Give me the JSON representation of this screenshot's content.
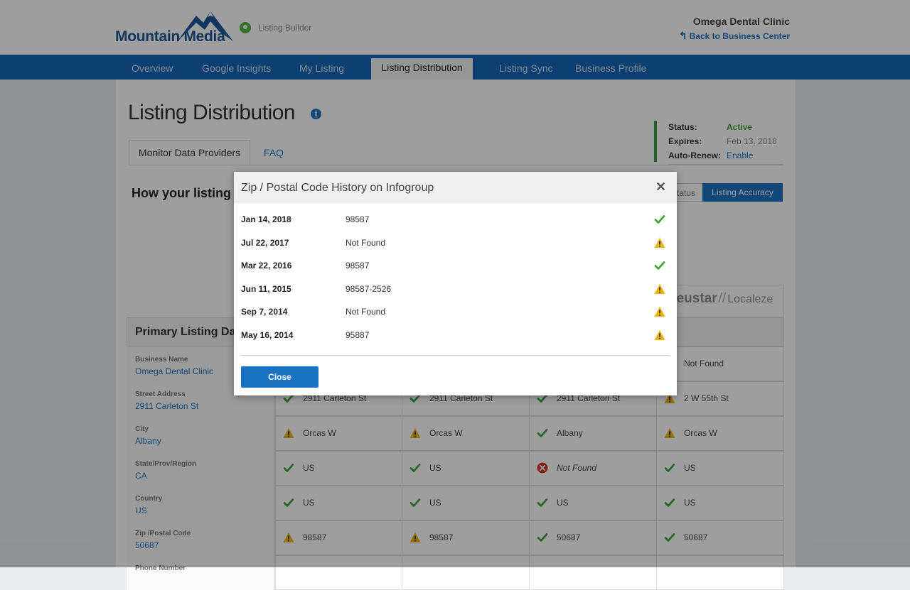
{
  "header": {
    "logo_text": "Mountain Media",
    "app_label": "Listing Builder",
    "business_name": "Omega Dental Clinic",
    "back_link": "Back to Business Center"
  },
  "nav": {
    "items": [
      "Overview",
      "Google Insights",
      "My Listing",
      "Listing Distribution",
      "Listing Sync",
      "Business Profile"
    ],
    "active": "Listing Distribution"
  },
  "page": {
    "title": "Listing Distribution",
    "tabs": [
      "Monitor Data Providers",
      "FAQ"
    ],
    "section_heading": "How your listing",
    "view_buttons": [
      "Status",
      "Listing Accuracy"
    ],
    "provider_logo": "neustar",
    "provider_logo_sub": "Localeze"
  },
  "status_panel": {
    "status_label": "Status:",
    "status_value": "Active",
    "expires_label": "Expires:",
    "expires_value": "Feb 13, 2018",
    "autorenew_label": "Auto-Renew:",
    "autorenew_value": "Enable",
    "colors": {
      "active": "#3fa63f",
      "link": "#1a73c2"
    }
  },
  "primary_listing": {
    "title": "Primary Listing Da",
    "rows": [
      {
        "label": "Business Name",
        "value": "Omega Dental Clinic",
        "cells": [
          {
            "status": "",
            "text": ""
          },
          {
            "status": "",
            "text": ""
          },
          {
            "status": "",
            "text": ""
          },
          {
            "status": "error",
            "text": "Not Found"
          }
        ]
      },
      {
        "label": "Street Address",
        "value": "2911 Carleton St",
        "cells": [
          {
            "status": "ok",
            "text": "2911 Carleton St"
          },
          {
            "status": "ok",
            "text": "2911 Carleton St"
          },
          {
            "status": "ok",
            "text": "2911 Carleton St"
          },
          {
            "status": "warn",
            "text": "2 W 55th St"
          }
        ]
      },
      {
        "label": "City",
        "value": "Albany",
        "cells": [
          {
            "status": "warn",
            "text": "Orcas W"
          },
          {
            "status": "warn",
            "text": "Orcas W"
          },
          {
            "status": "ok",
            "text": "Albany"
          },
          {
            "status": "warn",
            "text": "Orcas W"
          }
        ]
      },
      {
        "label": "State/Prov/Region",
        "value": "CA",
        "cells": [
          {
            "status": "ok",
            "text": "US"
          },
          {
            "status": "ok",
            "text": "US"
          },
          {
            "status": "error",
            "text": "Not Found"
          },
          {
            "status": "ok",
            "text": "US"
          }
        ]
      },
      {
        "label": "Country",
        "value": "US",
        "cells": [
          {
            "status": "ok",
            "text": "US"
          },
          {
            "status": "ok",
            "text": "US"
          },
          {
            "status": "ok",
            "text": "US"
          },
          {
            "status": "ok",
            "text": "US"
          }
        ]
      },
      {
        "label": "Zip /Postal Code",
        "value": "50687",
        "cells": [
          {
            "status": "warn",
            "text": "98587"
          },
          {
            "status": "warn",
            "text": "98587"
          },
          {
            "status": "ok",
            "text": "50687"
          },
          {
            "status": "ok",
            "text": "50687"
          }
        ]
      },
      {
        "label": "Phone Number",
        "value": "",
        "cells": []
      }
    ]
  },
  "modal": {
    "title": "Zip / Postal Code History on Infogroup",
    "history": [
      {
        "date": "Jan 14, 2018",
        "value": "98587",
        "status": "ok"
      },
      {
        "date": "Jul 22, 2017",
        "value": "Not Found",
        "status": "warn"
      },
      {
        "date": "Mar 22, 2016",
        "value": "98587",
        "status": "ok"
      },
      {
        "date": "Jun 11, 2015",
        "value": "98587-2526",
        "status": "warn"
      },
      {
        "date": "Sep 7, 2014",
        "value": "Not Found",
        "status": "warn"
      },
      {
        "date": "May 16, 2014",
        "value": "95887",
        "status": "warn"
      }
    ],
    "close_label": "Close"
  },
  "icons": {
    "ok": "check-icon",
    "warn": "warning-icon",
    "error": "error-icon",
    "colors": {
      "ok": "#3fa63f",
      "warn": "#f0b400",
      "error": "#d9342b"
    }
  }
}
